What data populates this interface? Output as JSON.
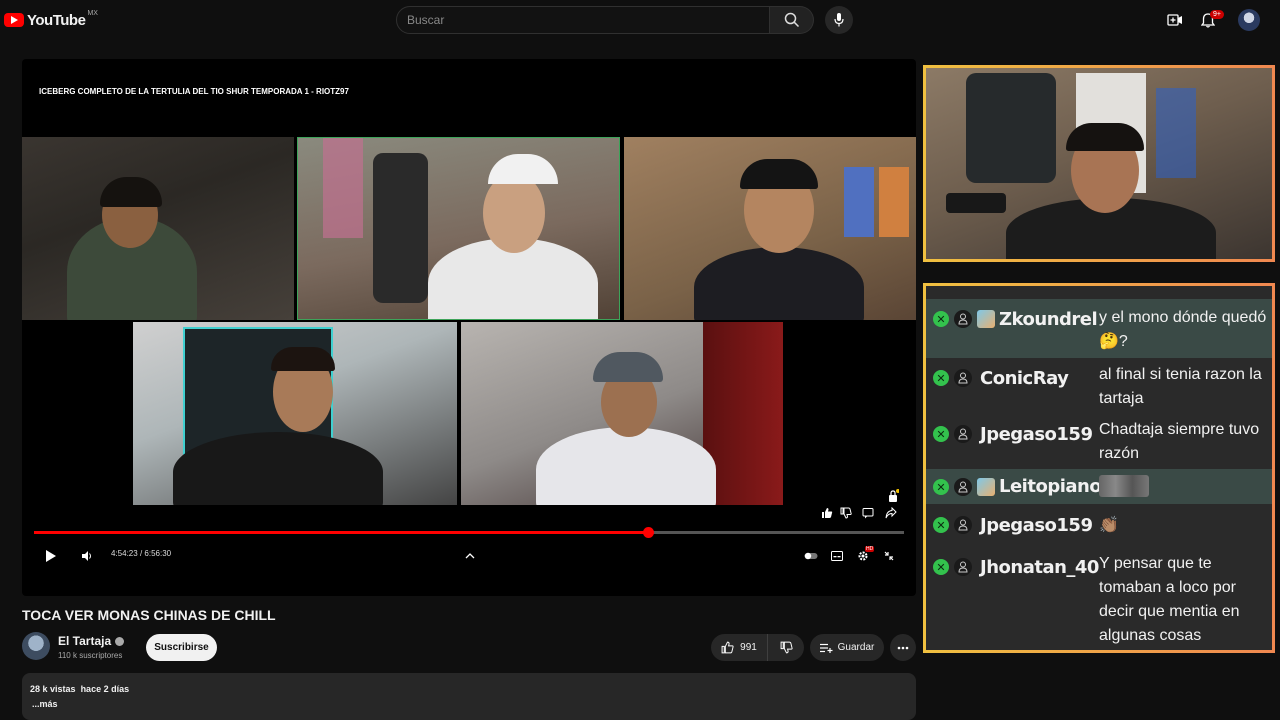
{
  "header": {
    "logo_text": "YouTube",
    "country_code": "MX",
    "search_placeholder": "Buscar",
    "notifications_count": "9+"
  },
  "player": {
    "overlay_title": "ICEBERG COMPLETO DE LA TERTULIA DEL TIO SHUR TEMPORADA 1 - RIOTZ97",
    "current_time": "4:54:23",
    "time_separator": "/",
    "duration": "6:56:30",
    "progress_percent": 70.6,
    "settings_badge": "HD"
  },
  "video": {
    "title": "TOCA VER MONAS CHINAS DE CHILL",
    "channel_name": "El Tartaja",
    "subscribers": "110 k suscriptores",
    "subscribe_label": "Suscribirse",
    "like_count": "991",
    "save_label": "Guardar",
    "views": "28 k vistas",
    "uploaded": "hace 2 días",
    "more_label": "...más"
  },
  "chat": {
    "messages": [
      {
        "user": "Zkoundrel",
        "badge": true,
        "highlight": true,
        "text": "y el mono dónde quedó 🤔?"
      },
      {
        "user": "ConicRay",
        "badge": false,
        "highlight": false,
        "text": "al final si tenia razon la tartaja"
      },
      {
        "user": "Jpegaso159",
        "badge": false,
        "highlight": false,
        "text": "Chadtaja siempre tuvo razón"
      },
      {
        "user": "Leitopiano",
        "badge": true,
        "highlight": true,
        "text": ""
      },
      {
        "user": "Jpegaso159",
        "badge": false,
        "highlight": false,
        "text": "👏🏽"
      },
      {
        "user": "Jhonatan_40",
        "badge": false,
        "highlight": false,
        "text": "Y pensar que te tomaban a loco por decir que mentia en algunas cosas"
      }
    ]
  },
  "colors": {
    "accent_red": "#ff0000",
    "overlay_border_start": "#f0c040",
    "overlay_border_end": "#f08850",
    "chat_check": "#33c24d"
  }
}
